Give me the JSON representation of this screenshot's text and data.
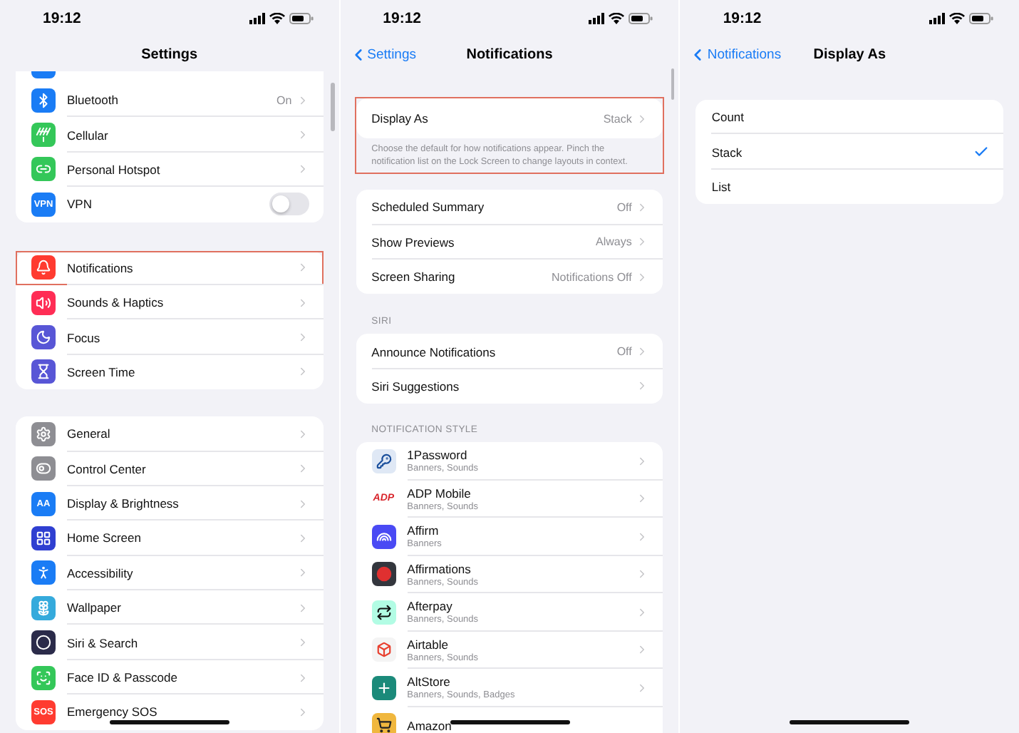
{
  "settings_screen": {
    "status_bar": {
      "time": "19:12"
    },
    "title": "Settings",
    "groups": [
      {
        "items": [
          {
            "label": "Bluetooth",
            "value": "On",
            "kind": "link",
            "highlighted": false,
            "color": "#1a7cf5"
          },
          {
            "label": "Cellular",
            "kind": "link",
            "highlighted": false,
            "color": "#34c759"
          },
          {
            "label": "Personal Hotspot",
            "kind": "link",
            "highlighted": false,
            "color": "#34c759"
          },
          {
            "label": "VPN",
            "kind": "toggle",
            "on": false,
            "icon_text": "VPN",
            "highlighted": false,
            "color": "#1a7cf5"
          }
        ]
      },
      {
        "items": [
          {
            "label": "Notifications",
            "kind": "link",
            "highlighted": true,
            "color": "#ff3b30"
          },
          {
            "label": "Sounds & Haptics",
            "kind": "link",
            "highlighted": false,
            "color": "#ff2d55"
          },
          {
            "label": "Focus",
            "kind": "link",
            "highlighted": false,
            "color": "#5856d6"
          },
          {
            "label": "Screen Time",
            "kind": "link",
            "highlighted": false,
            "color": "#5856d6"
          }
        ]
      },
      {
        "items": [
          {
            "label": "General",
            "kind": "link",
            "highlighted": false,
            "color": "#8e8e93"
          },
          {
            "label": "Control Center",
            "kind": "link",
            "highlighted": false,
            "color": "#8e8e93"
          },
          {
            "label": "Display & Brightness",
            "kind": "link",
            "icon_text": "AA",
            "highlighted": false,
            "color": "#1a7cf5"
          },
          {
            "label": "Home Screen",
            "kind": "link",
            "highlighted": false,
            "color": "#2f3fd1"
          },
          {
            "label": "Accessibility",
            "kind": "link",
            "highlighted": false,
            "color": "#1a7cf5"
          },
          {
            "label": "Wallpaper",
            "kind": "link",
            "highlighted": false,
            "color": "#35aadc"
          },
          {
            "label": "Siri & Search",
            "kind": "link",
            "highlighted": false,
            "color": "#2b2b4a"
          },
          {
            "label": "Face ID & Passcode",
            "kind": "link",
            "highlighted": false,
            "color": "#34c759"
          },
          {
            "label": "Emergency SOS",
            "kind": "link",
            "icon_text": "SOS",
            "highlighted": false,
            "color": "#ff3b30"
          }
        ]
      }
    ]
  },
  "notifications_screen": {
    "status_bar": {
      "time": "19:12"
    },
    "back": "Settings",
    "title": "Notifications",
    "display_as": {
      "label": "Display As",
      "value": "Stack",
      "footer": "Choose the default for how notifications appear. Pinch the notification list on the Lock Screen to change layouts in context.",
      "highlighted": true
    },
    "groups": [
      {
        "items": [
          {
            "label": "Scheduled Summary",
            "value": "Off"
          },
          {
            "label": "Show Previews",
            "value": "Always"
          },
          {
            "label": "Screen Sharing",
            "value": "Notifications Off"
          }
        ]
      },
      {
        "header": "SIRI",
        "items": [
          {
            "label": "Announce Notifications",
            "value": "Off"
          },
          {
            "label": "Siri Suggestions"
          }
        ]
      }
    ],
    "style_header": "NOTIFICATION STYLE",
    "apps": [
      {
        "name": "1Password",
        "detail": "Banners, Sounds",
        "color": "#dfe8f5"
      },
      {
        "name": "ADP Mobile",
        "detail": "Banners, Sounds",
        "icon_text": "ADP",
        "color": "#ffffff"
      },
      {
        "name": "Affirm",
        "detail": "Banners",
        "color": "#4a4af4"
      },
      {
        "name": "Affirmations",
        "detail": "Banners, Sounds",
        "color": "#33363d"
      },
      {
        "name": "Afterpay",
        "detail": "Banners, Sounds",
        "color": "#b2fce4"
      },
      {
        "name": "Airtable",
        "detail": "Banners, Sounds",
        "color": "#f4f4f4"
      },
      {
        "name": "AltStore",
        "detail": "Banners, Sounds, Badges",
        "color": "#1b8a7a"
      },
      {
        "name": "Amazon",
        "color": "#f0b73e"
      }
    ]
  },
  "display_as_screen": {
    "status_bar": {
      "time": "19:12"
    },
    "back": "Notifications",
    "title": "Display As",
    "options": [
      {
        "label": "Count",
        "selected": false
      },
      {
        "label": "Stack",
        "selected": true
      },
      {
        "label": "List",
        "selected": false
      }
    ]
  }
}
